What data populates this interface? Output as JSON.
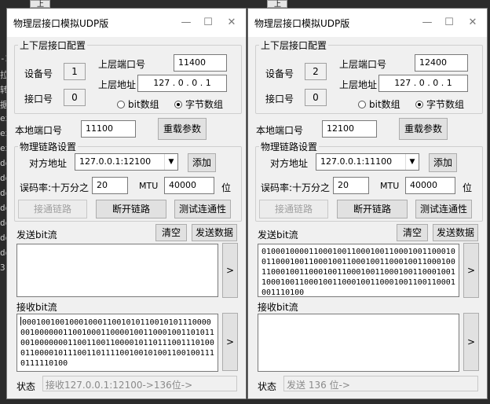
{
  "background": {
    "left_fragments": [
      "-2",
      "拉",
      "转",
      "据",
      "ex",
      "ex",
      "ex",
      "de",
      "de",
      "de",
      "de",
      "de",
      "de",
      "de",
      "3"
    ],
    "top_tab_label": "上"
  },
  "windows": [
    {
      "title": "物理层接口模拟UDP版",
      "upper_group_title": "上下层接口配置",
      "device_label": "设备号",
      "device_value": "1",
      "interface_label": "接口号",
      "interface_value": "0",
      "upper_port_label": "上层端口号",
      "upper_port_value": "11400",
      "upper_addr_label": "上层地址",
      "upper_addr_value": "127 . 0 . 0 . 1",
      "radio_bit": "bit数组",
      "radio_byte": "字节数组",
      "radio_selected": "byte",
      "local_port_label": "本地端口号",
      "local_port_value": "11100",
      "reload_button": "重载参数",
      "link_group_title": "物理链路设置",
      "peer_label": "对方地址",
      "peer_value": "127.0.0.1:12100",
      "add_button": "添加",
      "ber_label": "误码率:十万分之",
      "ber_value": "20",
      "mtu_label": "MTU",
      "mtu_value": "40000",
      "mtu_unit": "位",
      "connect_button": "接通链路",
      "disconnect_button": "断开链路",
      "test_button": "测试连通性",
      "send_label": "发送bit流",
      "clear_button": "清空",
      "send_data_button": "发送数据",
      "send_text": "",
      "send_arrow": ">",
      "recv_label": "接收bit流",
      "recv_text": "00010010010001000110010101100101011100000010000001100100011000010011000100110101100100000001100110011000010110111001110100011000010111001101111001001010011001001110111110100",
      "recv_arrow": ">",
      "status_label": "状态",
      "status_text": "接收127.0.0.1:12100->136位->"
    },
    {
      "title": "物理层接口模拟UDP版",
      "upper_group_title": "上下层接口配置",
      "device_label": "设备号",
      "device_value": "2",
      "interface_label": "接口号",
      "interface_value": "0",
      "upper_port_label": "上层端口号",
      "upper_port_value": "12400",
      "upper_addr_label": "上层地址",
      "upper_addr_value": "127 . 0 . 0 . 1",
      "radio_bit": "bit数组",
      "radio_byte": "字节数组",
      "radio_selected": "byte",
      "local_port_label": "本地端口号",
      "local_port_value": "12100",
      "reload_button": "重载参数",
      "link_group_title": "物理链路设置",
      "peer_label": "对方地址",
      "peer_value": "127.0.0.1:11100",
      "add_button": "添加",
      "ber_label": "误码率:十万分之",
      "ber_value": "20",
      "mtu_label": "MTU",
      "mtu_value": "40000",
      "mtu_unit": "位",
      "connect_button": "接通链路",
      "disconnect_button": "断开链路",
      "test_button": "测试连通性",
      "send_label": "发送bit流",
      "clear_button": "清空",
      "send_data_button": "发送数据",
      "send_text": "01000100001100010011000100110001001100010011000100110001001100010011000100110001001100010011000100110001001100010011000100110001001100010011000100110001001100110001001110100",
      "send_arrow": ">",
      "recv_label": "接收bit流",
      "recv_text": "",
      "recv_arrow": ">",
      "status_label": "状态",
      "status_text": "发送 136 位->"
    }
  ]
}
